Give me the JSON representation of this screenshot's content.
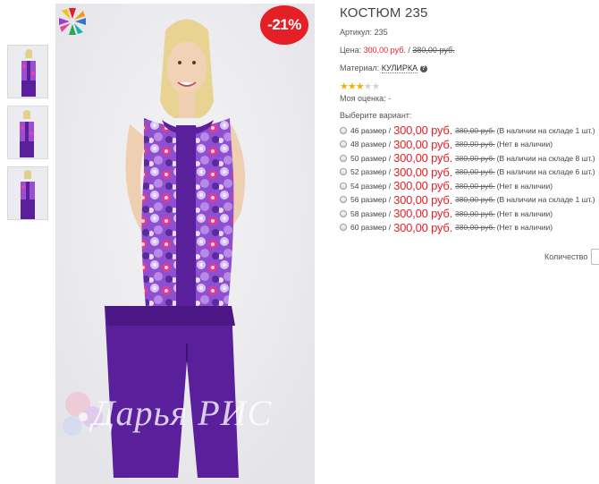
{
  "product": {
    "title": "КОСТЮМ 235",
    "sku_label": "Артикул:",
    "sku_value": "235",
    "price_label": "Цена:",
    "price_current": "300,00 руб.",
    "price_separator": "/",
    "price_old": "380,00 руб.",
    "material_label": "Материал:",
    "material_value": "КУЛИРКА",
    "material_help_icon": "?",
    "rating": {
      "filled": 3,
      "total": 5
    },
    "my_rating_label": "Моя оценка: -",
    "choose_variant_label": "Выберите вариант:",
    "discount_badge": "-21%",
    "watermark_text": "Дарья РИС",
    "quantity_label": "Количество"
  },
  "variants": [
    {
      "size": "46 размер",
      "price": "300,00 руб.",
      "old": "380,00 руб.",
      "stock": "(В наличии на складе 1 шт.)"
    },
    {
      "size": "48 размер",
      "price": "300,00 руб.",
      "old": "380,00 руб.",
      "stock": "(Нет в наличии)"
    },
    {
      "size": "50 размер",
      "price": "300,00 руб.",
      "old": "380,00 руб.",
      "stock": "(В наличии на складе 8 шт.)"
    },
    {
      "size": "52 размер",
      "price": "300,00 руб.",
      "old": "380,00 руб.",
      "stock": "(В наличии на складе 6 шт.)"
    },
    {
      "size": "54 размер",
      "price": "300,00 руб.",
      "old": "380,00 руб.",
      "stock": "(Нет в наличии)"
    },
    {
      "size": "56 размер",
      "price": "300,00 руб.",
      "old": "380,00 руб.",
      "stock": "(В наличии на складе 1 шт.)"
    },
    {
      "size": "58 размер",
      "price": "300,00 руб.",
      "old": "380,00 руб.",
      "stock": "(Нет в наличии)"
    },
    {
      "size": "60 размер",
      "price": "300,00 руб.",
      "old": "380,00 руб.",
      "stock": "(Нет в наличии)"
    }
  ],
  "colors": {
    "accent": "#e42026",
    "outfit_purple": "#5a1f9a",
    "star_on": "#f0b400",
    "star_off": "#d4d4d4"
  },
  "icons": {
    "brand_logo": "flower-logo-icon",
    "rating_star": "star-icon",
    "help": "question-icon",
    "radio": "radio-icon"
  }
}
